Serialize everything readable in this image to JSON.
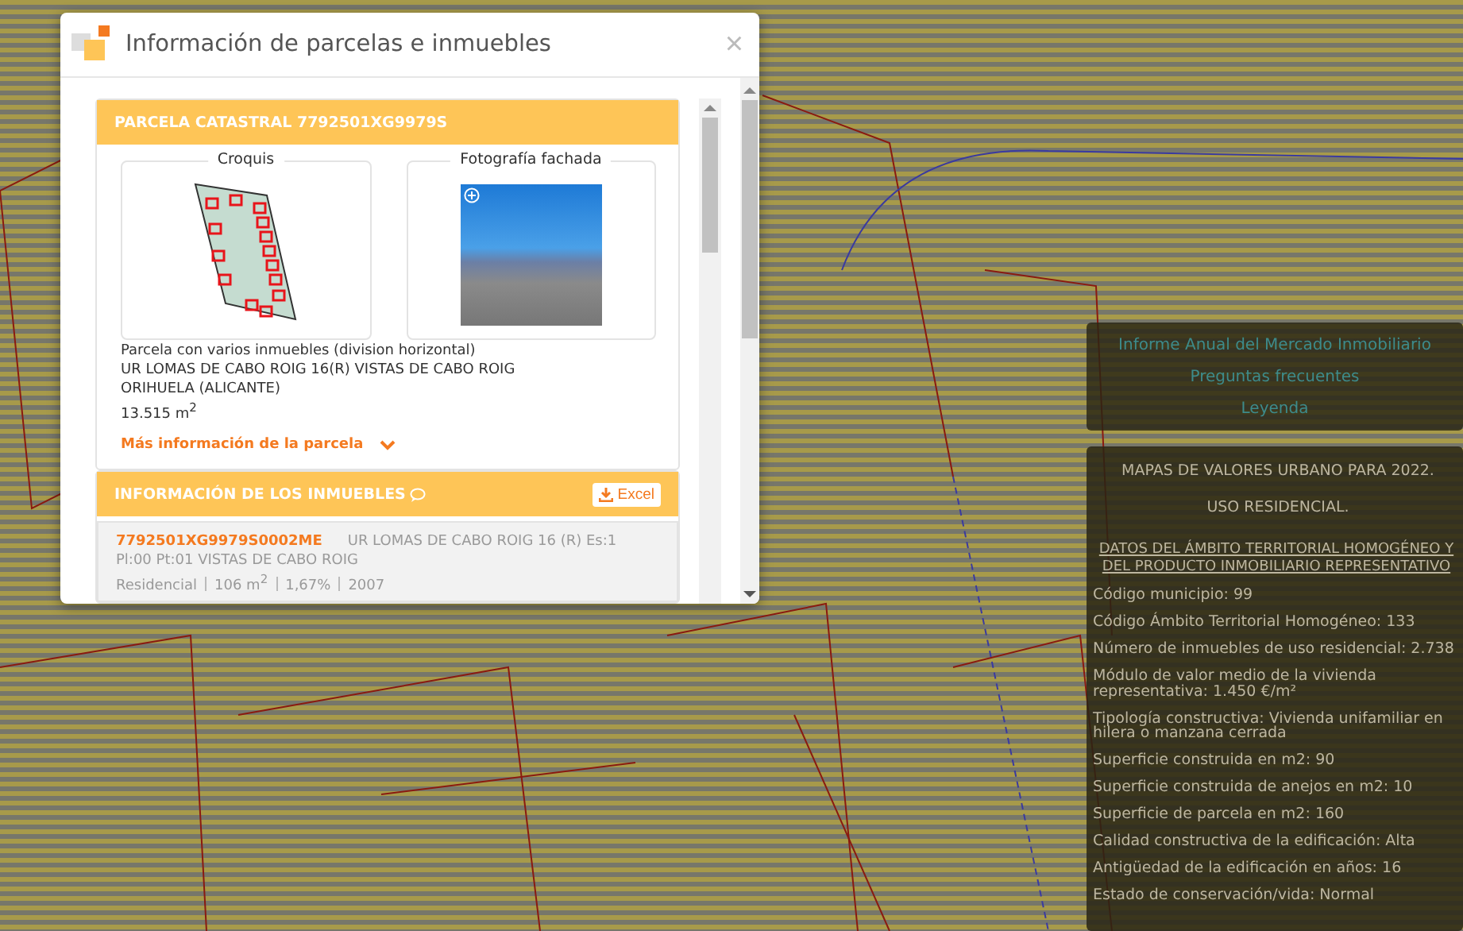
{
  "dialog": {
    "title": "Información de parcelas e inmuebles",
    "close": "×",
    "parcel": {
      "heading": "PARCELA CATASTRAL 7792501XG9979S",
      "sketch_label": "Croquis",
      "photo_label": "Fotografía fachada",
      "lines": [
        "Parcela con varios inmuebles (division horizontal)",
        "UR LOMAS DE CABO ROIG 16(R) VISTAS DE CABO ROIG",
        "ORIHUELA (ALICANTE)",
        "13.515 m$^{2}$"
      ],
      "more_link": "Más información de la parcela",
      "expanded": false
    },
    "properties": {
      "heading": "INFORMACIÓN DE LOS INMUEBLES",
      "excel": "Excel",
      "items": [
        {
          "ref": "7792501XG9979S0002ME",
          "address": "UR LOMAS DE CABO ROIG 16 (R) Es:1",
          "address2": "Pl:00 Pt:01 VISTAS DE CABO ROIG",
          "details": [
            "Residencial",
            "106 m$^{2}$",
            "1,67%",
            "2007"
          ]
        }
      ]
    }
  },
  "links": [
    "Informe Anual del Mercado Inmobiliario",
    "Preguntas frecuentes",
    "Leyenda"
  ],
  "values_panel": {
    "titles": [
      "MAPAS DE VALORES URBANO PARA 2022.",
      "USO RESIDENCIAL."
    ],
    "subtitle": "DATOS DEL ÁMBITO TERRITORIAL HOMOGÉNEO Y DEL PRODUCTO INMOBILIARIO REPRESENTATIVO",
    "facts": [
      "Código municipio: 99",
      "Código Ámbito Territorial Homogéneo: 133",
      "Número de inmuebles de uso residencial: 2.738",
      "Módulo de valor medio de la vivienda representativa: 1.450 €/m²",
      "Tipología constructiva: Vivienda unifamiliar en hilera o manzana cerrada",
      "Superficie construida en m2: 90",
      "Superficie construida de anejos en m2: 10",
      "Superficie de parcela en m2: 160",
      "Calidad constructiva de la edificación: Alta",
      "Antigüedad de la edificación en años: 16",
      "Estado de conservación/vida: Normal"
    ]
  }
}
